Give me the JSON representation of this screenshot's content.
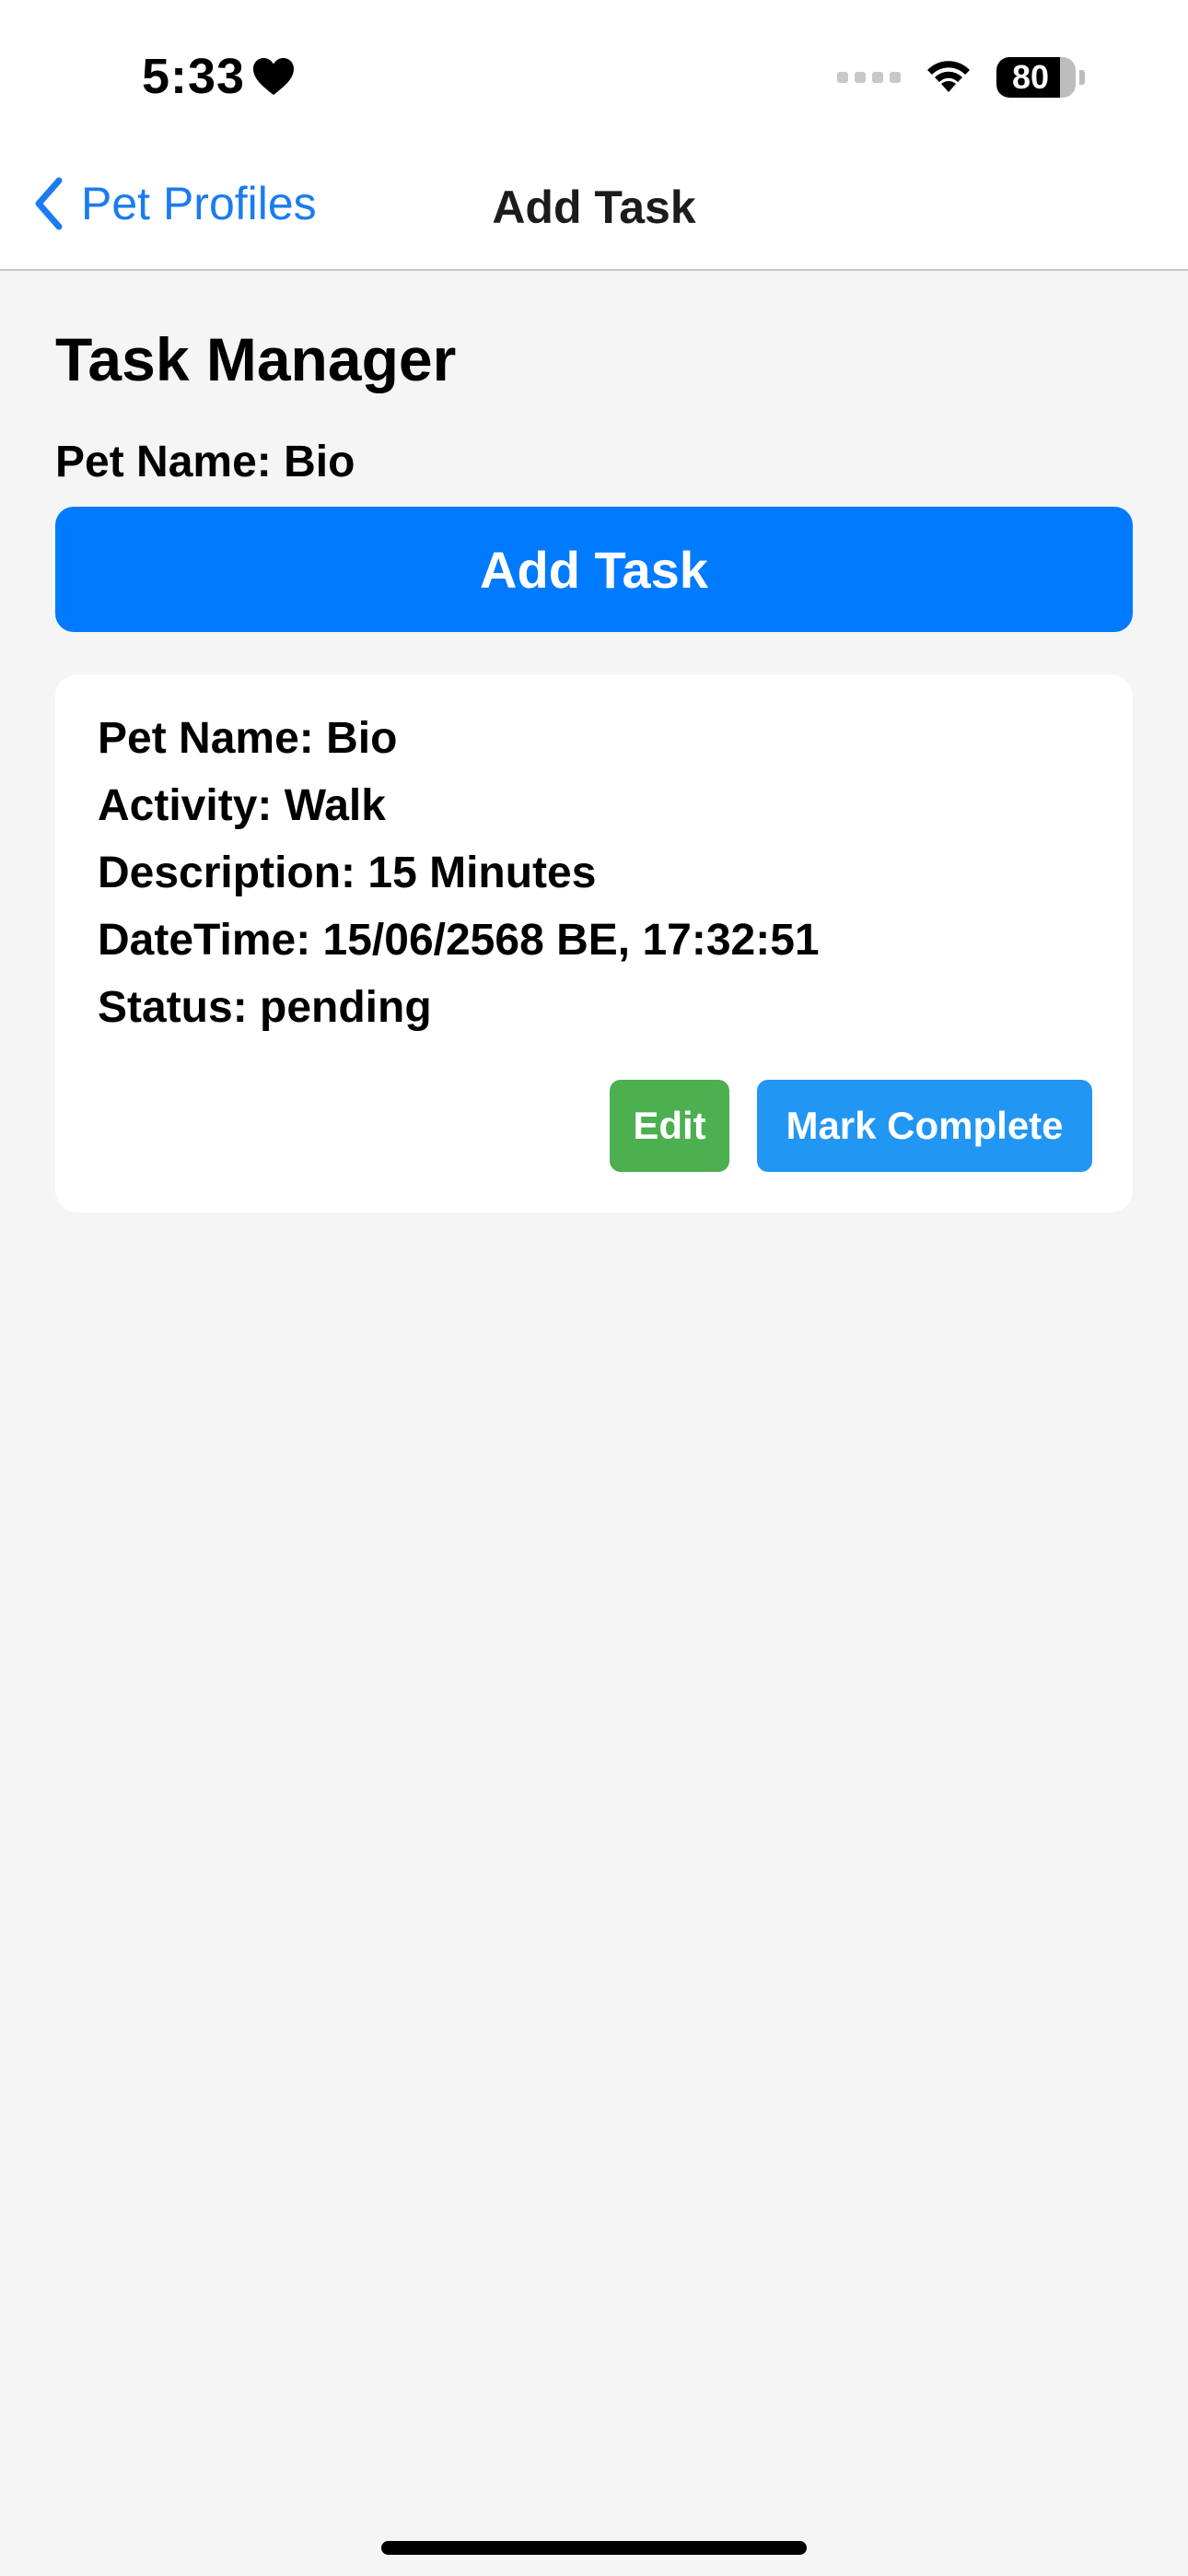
{
  "status_bar": {
    "time": "5:33",
    "battery_level": "80",
    "battery_fraction": 0.8
  },
  "nav": {
    "back_label": "Pet Profiles",
    "title": "Add Task"
  },
  "page": {
    "title": "Task Manager",
    "pet_name_label": "Pet Name: Bio",
    "add_task_label": "Add Task"
  },
  "tasks": [
    {
      "pet_name": "Pet Name: Bio",
      "activity": "Activity: Walk",
      "description": "Description: 15 Minutes",
      "datetime": "DateTime: 15/06/2568 BE, 17:32:51",
      "status": "Status: pending",
      "edit_label": "Edit",
      "complete_label": "Mark Complete"
    }
  ],
  "colors": {
    "accent": "#007aff",
    "link": "#1a7cf0",
    "edit": "#4caf50",
    "complete": "#2196f3",
    "background": "#f5f5f5",
    "card": "#ffffff"
  },
  "icons": {
    "status": [
      "heart-icon",
      "signal-icon",
      "wifi-icon",
      "battery-icon"
    ],
    "nav": [
      "chevron-left-icon"
    ]
  }
}
